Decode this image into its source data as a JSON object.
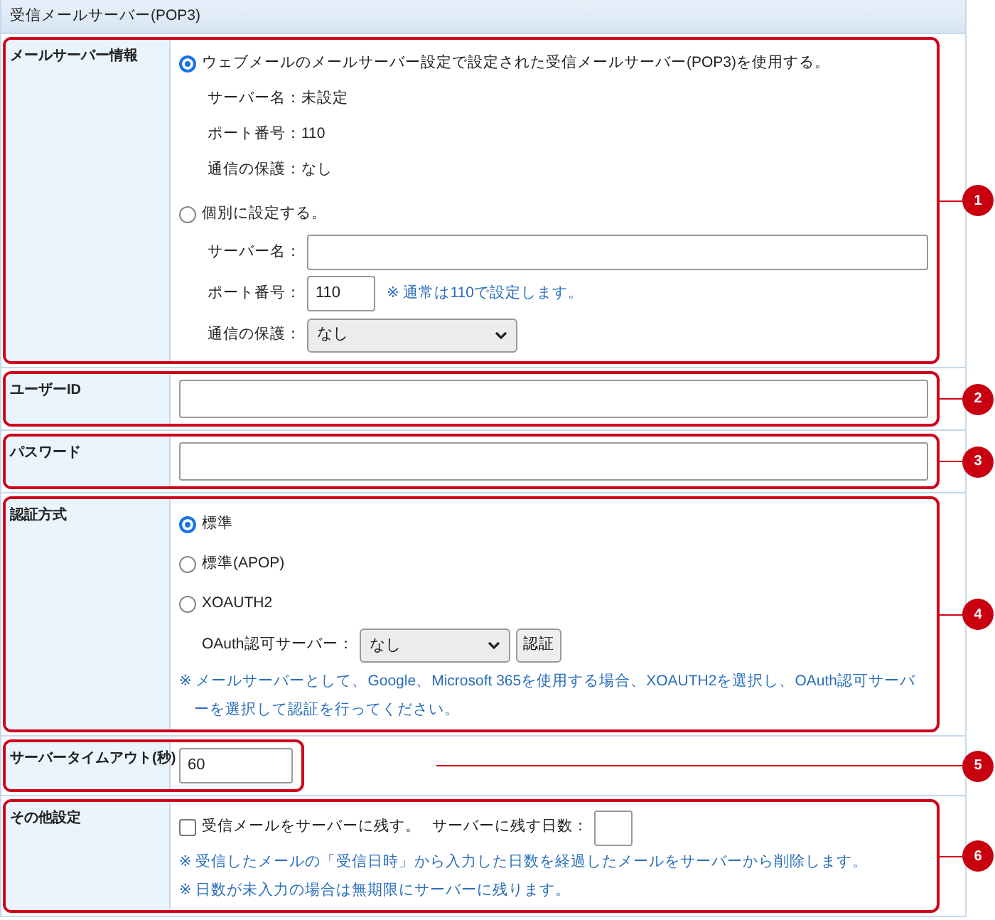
{
  "section_title": "受信メールサーバー(POP3)",
  "rows": [
    {
      "kind": "server_info",
      "callout": "1",
      "label": "メールサーバー情報",
      "options": [
        {
          "label": "ウェブメールのメールサーバー設定で設定された受信メールサーバー(POP3)を使用する。",
          "selected": true
        },
        {
          "label": "個別に設定する。",
          "selected": false
        }
      ],
      "info": [
        "サーバー名：未設定",
        "ポート番号：110",
        "通信の保護：なし"
      ],
      "server_name_label": "サーバー名：",
      "port_label": "ポート番号：",
      "port_value": "110",
      "port_note": "※ 通常は110で設定します。",
      "security_label": "通信の保護：",
      "security_value": "なし"
    },
    {
      "kind": "text_input",
      "callout": "2",
      "label": "ユーザーID"
    },
    {
      "kind": "text_input",
      "callout": "3",
      "label": "パスワード"
    },
    {
      "kind": "auth",
      "callout": "4",
      "label": "認証方式",
      "options": [
        {
          "label": "標準",
          "selected": true
        },
        {
          "label": "標準(APOP)",
          "selected": false
        },
        {
          "label": "XOAUTH2",
          "selected": false
        }
      ],
      "oauth_label": "OAuth認可サーバー：",
      "oauth_value": "なし",
      "auth_button": "認証",
      "note": "※ メールサーバーとして、Google、Microsoft 365を使用する場合、XOAUTH2を選択し、OAuth認可サーバーを選択して認証を行ってください。"
    },
    {
      "kind": "short_input",
      "callout": "5",
      "label": "サーバータイムアウト(秒)",
      "value": "60"
    },
    {
      "kind": "other",
      "callout": "6",
      "label": "その他設定",
      "checkbox": {
        "label": "受信メールをサーバーに残す。",
        "checked": false
      },
      "days_label": "サーバーに残す日数：",
      "notes": [
        "※ 受信したメールの「受信日時」から入力した日数を経過したメールをサーバーから削除します。",
        "※ 日数が未入力の場合は無期限にサーバーに残ります。"
      ]
    }
  ]
}
